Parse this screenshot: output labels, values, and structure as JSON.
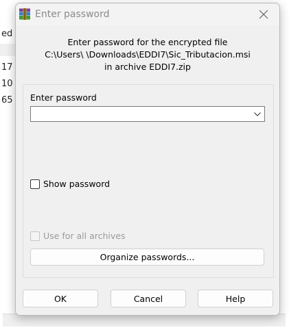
{
  "background": {
    "rows": [
      "ed",
      "17",
      "10",
      "65"
    ]
  },
  "dialog": {
    "title": "Enter password",
    "message_line1": "Enter password for the encrypted file",
    "message_line2": "C:\\Users\\ \\Downloads\\EDDI7\\Sic_Tributacion.msi",
    "message_line3": "in archive EDDI7.zip",
    "password_label": "Enter password",
    "password_value": "",
    "show_password_label": "Show password",
    "use_for_all_label": "Use for all archives",
    "organize_label": "Organize passwords...",
    "ok_label": "OK",
    "cancel_label": "Cancel",
    "help_label": "Help"
  },
  "icons": {
    "app": "winrar-icon",
    "close": "close-icon",
    "dropdown": "chevron-down-icon"
  }
}
